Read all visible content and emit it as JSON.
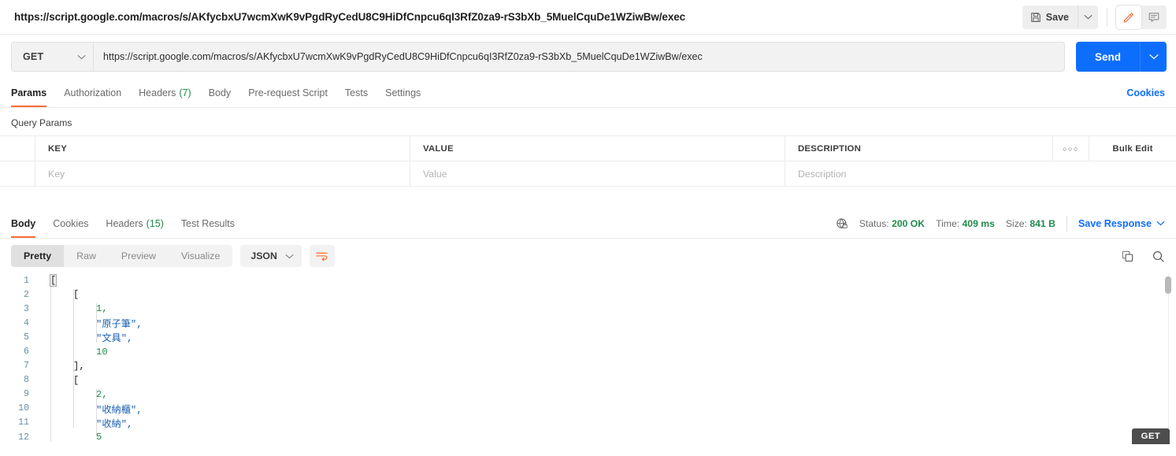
{
  "topbar": {
    "request_title": "https://script.google.com/macros/s/AKfycbxU7wcmXwK9vPgdRyCedU8C9HiDfCnpcu6qI3RfZ0za9-rS3bXb_5MuelCquDe1WZiwBw/exec",
    "save_label": "Save",
    "save_icon": "floppy-disk-icon",
    "save_caret_icon": "chevron-down-icon",
    "edit_icon": "pencil-icon",
    "comment_icon": "comment-icon",
    "accent_color": "#ff6c37"
  },
  "url_bar": {
    "method": "GET",
    "method_caret_icon": "chevron-down-icon",
    "url": "https://script.google.com/macros/s/AKfycbxU7wcmXwK9vPgdRyCedU8C9HiDfCnpcu6qI3RfZ0za9-rS3bXb_5MuelCquDe1WZiwBw/exec",
    "send_label": "Send",
    "send_caret_icon": "chevron-down-icon",
    "send_color": "#0d6efd"
  },
  "request_tabs": {
    "items": [
      {
        "label": "Params",
        "count": "",
        "active": true
      },
      {
        "label": "Authorization",
        "count": "",
        "active": false
      },
      {
        "label": "Headers",
        "count": "(7)",
        "active": false
      },
      {
        "label": "Body",
        "count": "",
        "active": false
      },
      {
        "label": "Pre-request Script",
        "count": "",
        "active": false
      },
      {
        "label": "Tests",
        "count": "",
        "active": false
      },
      {
        "label": "Settings",
        "count": "",
        "active": false
      }
    ],
    "cookies_label": "Cookies"
  },
  "query_params": {
    "section_label": "Query Params",
    "headers": {
      "key": "KEY",
      "value": "VALUE",
      "description": "DESCRIPTION"
    },
    "options_icon": "more-options-icon",
    "bulk_edit_label": "Bulk Edit",
    "row_placeholders": {
      "key": "Key",
      "value": "Value",
      "description": "Description"
    }
  },
  "response_tabs": {
    "items": [
      {
        "label": "Body",
        "count": "",
        "active": true
      },
      {
        "label": "Cookies",
        "count": "",
        "active": false
      },
      {
        "label": "Headers",
        "count": "(15)",
        "active": false
      },
      {
        "label": "Test Results",
        "count": "",
        "active": false
      }
    ],
    "meta": {
      "shield_icon": "globe-lock-icon",
      "status_label": "Status:",
      "status_value": "200 OK",
      "time_label": "Time:",
      "time_value": "409 ms",
      "size_label": "Size:",
      "size_value": "841 B",
      "save_response_label": "Save Response",
      "save_response_caret_icon": "chevron-down-icon"
    }
  },
  "response_toolbar": {
    "views": [
      {
        "label": "Pretty",
        "active": true
      },
      {
        "label": "Raw",
        "active": false
      },
      {
        "label": "Preview",
        "active": false
      },
      {
        "label": "Visualize",
        "active": false
      }
    ],
    "format": "JSON",
    "format_caret_icon": "chevron-down-icon",
    "wrap_icon": "wrap-lines-icon",
    "copy_icon": "copy-icon",
    "search_icon": "search-icon"
  },
  "response_body": {
    "lines": [
      {
        "n": "1",
        "indent": 0,
        "text": "[",
        "type": "punct",
        "highlight": true
      },
      {
        "n": "2",
        "indent": 1,
        "text": "[",
        "type": "punct",
        "highlight": false
      },
      {
        "n": "3",
        "indent": 2,
        "text": "1,",
        "type": "number",
        "highlight": false
      },
      {
        "n": "4",
        "indent": 2,
        "text": "\"原子筆\",",
        "type": "string",
        "highlight": false
      },
      {
        "n": "5",
        "indent": 2,
        "text": "\"文具\",",
        "type": "string",
        "highlight": false
      },
      {
        "n": "6",
        "indent": 2,
        "text": "10",
        "type": "number",
        "highlight": false
      },
      {
        "n": "7",
        "indent": 1,
        "text": "],",
        "type": "punct",
        "highlight": false
      },
      {
        "n": "8",
        "indent": 1,
        "text": "[",
        "type": "punct",
        "highlight": false
      },
      {
        "n": "9",
        "indent": 2,
        "text": "2,",
        "type": "number",
        "highlight": false
      },
      {
        "n": "10",
        "indent": 2,
        "text": "\"收納櫃\",",
        "type": "string",
        "highlight": false
      },
      {
        "n": "11",
        "indent": 2,
        "text": "\"收納\",",
        "type": "string",
        "highlight": false
      },
      {
        "n": "12",
        "indent": 2,
        "text": "5",
        "type": "number",
        "highlight": false
      }
    ],
    "status_badge": "GET"
  }
}
